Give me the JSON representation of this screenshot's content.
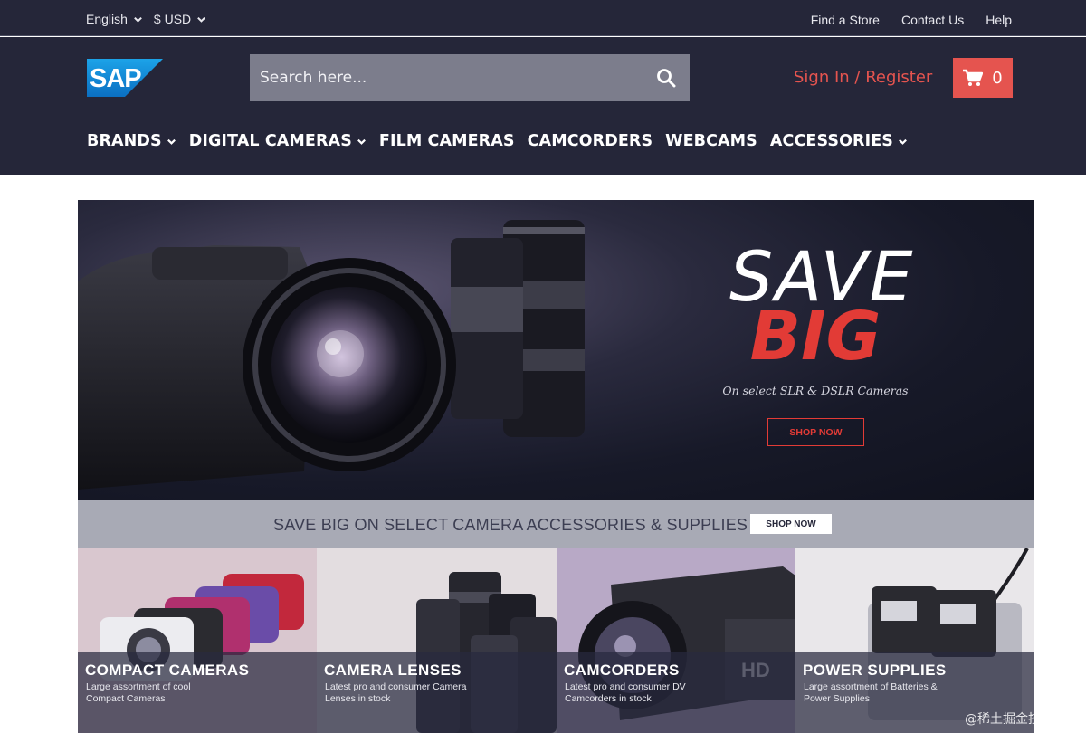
{
  "topbar": {
    "language": "English",
    "currency": "$ USD",
    "links": [
      "Find a Store",
      "Contact Us",
      "Help"
    ]
  },
  "header": {
    "logo_text": "SAP",
    "search_placeholder": "Search here...",
    "signin_label": "Sign In / Register",
    "cart_count": "0"
  },
  "nav": {
    "items": [
      {
        "label": "BRANDS",
        "has_dropdown": true
      },
      {
        "label": "DIGITAL CAMERAS",
        "has_dropdown": true
      },
      {
        "label": "FILM CAMERAS",
        "has_dropdown": false
      },
      {
        "label": "CAMCORDERS",
        "has_dropdown": false
      },
      {
        "label": "WEBCAMS",
        "has_dropdown": false
      },
      {
        "label": "ACCESSORIES",
        "has_dropdown": true
      }
    ]
  },
  "hero": {
    "line1": "SAVE",
    "line2": "BIG",
    "subtitle": "On select SLR & DSLR Cameras",
    "button": "SHOP NOW"
  },
  "promo": {
    "text": "SAVE BIG ON SELECT CAMERA ACCESSORIES & SUPPLIES",
    "button": "SHOP NOW"
  },
  "categories": [
    {
      "title": "COMPACT CAMERAS",
      "description": "Large assortment of cool Compact Cameras"
    },
    {
      "title": "CAMERA LENSES",
      "description": "Latest pro and consumer Camera Lenses in stock"
    },
    {
      "title": "CAMCORDERS",
      "description": "Latest pro and consumer DV Camcorders in stock"
    },
    {
      "title": "POWER SUPPLIES",
      "description": "Large assortment of Batteries & Power Supplies"
    }
  ],
  "watermark": "@稀土掘金技术社区",
  "colors": {
    "header_bg": "#252639",
    "accent_red": "#e5544f",
    "search_bg": "#7c7d8c",
    "strip_bg": "#a8aab5"
  },
  "icons": {
    "search": "search-icon",
    "cart": "cart-icon",
    "dropdown": "chevron-down-icon"
  }
}
